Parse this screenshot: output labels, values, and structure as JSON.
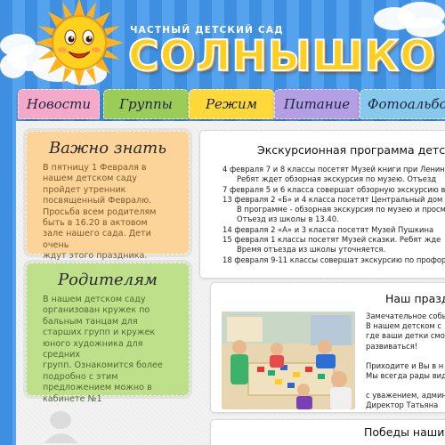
{
  "header": {
    "subtitle": "ЧАСТНЫЙ ДЕТСКИЙ САД",
    "title": "СОЛНЫШКО"
  },
  "nav": {
    "tabs": [
      {
        "label": "Новости",
        "color": "#f5a9c8"
      },
      {
        "label": "Группы",
        "color": "#9ccc58"
      },
      {
        "label": "Режим",
        "color": "#ffd93a"
      },
      {
        "label": "Питание",
        "color": "#b49ee4"
      },
      {
        "label": "Фотоальбом",
        "color": "#86c9ec"
      }
    ]
  },
  "sidebar": {
    "important": {
      "title": "Важно знать",
      "lines": [
        "В пятницу 1 Февраля в",
        "нашем детском саду",
        "пройдет утренник",
        "посвященный Февралю.",
        "Просьба всем родителям",
        "быть в 16.20 в актовом",
        "зале нашего сада. Дети очень",
        "ждут этого праздника."
      ],
      "color": "#fcd49a"
    },
    "parents": {
      "title": "Родителям",
      "lines": [
        "В нашем детском саду",
        "организован кружек по",
        "бальным танцам для",
        "старших групп и кружек",
        "юного художника для средних",
        "групп. Ознакомится более",
        "подробно с этим",
        "предложением можно в",
        "кабинете №1"
      ],
      "color": "#bfe08a"
    }
  },
  "excursions": {
    "title": "Экскурсионная программа детс",
    "lines": [
      {
        "text": "4 февраля 7 и 8 классы посетят Музей книги при Ленин",
        "indent": false
      },
      {
        "text": "Ребят ждет обзорная     экскурсия по музею. Отъезд",
        "indent": true
      },
      {
        "text": "7 февраля 5 и 6 класса совершат обзорную экскурсию в",
        "indent": false
      },
      {
        "text": "13 февраля 2 «Б» и 4 класса посетят Центральный дом",
        "indent": false
      },
      {
        "text": "В программе - обзорная экскурсия по музею и просм",
        "indent": true
      },
      {
        "text": "Отъезд из школы в 13.40.",
        "indent": true
      },
      {
        "text": "14 февраля 2 «А» и 3 класса посетят Музей Пушкина",
        "indent": false
      },
      {
        "text": "15 февраля 1 классы посетят Музей сказки. Ребят жде",
        "indent": false
      },
      {
        "text": "Время отъезда из школы уточняется.",
        "indent": true
      },
      {
        "text": "18 февраля 9-11 классы совершат экскурсию по профор",
        "indent": false
      }
    ]
  },
  "holiday": {
    "title": "Наш праздн",
    "lines": [
      "Замечательное собы",
      "В нашем детском с",
      "где ваши детки смо",
      "развиваться!",
      "",
      "Приходите и Вы в н",
      "Мы всегда рады вид",
      "",
      "с уважением, админ",
      "Директор Татьяна"
    ]
  },
  "bottom_panel": {
    "title": "Победы наших"
  }
}
